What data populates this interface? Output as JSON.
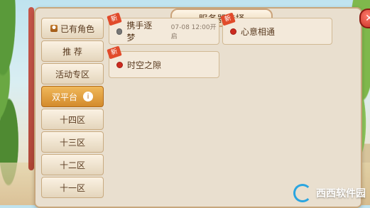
{
  "title": "服务器选择",
  "close": {
    "label": "✕"
  },
  "left_menu": {
    "items": [
      {
        "label": "已有角色"
      },
      {
        "label": "推 荐"
      },
      {
        "label": "活动专区"
      },
      {
        "label": "双平台",
        "info": "i",
        "active": true
      },
      {
        "label": "十四区"
      },
      {
        "label": "十三区"
      },
      {
        "label": "十二区"
      },
      {
        "label": "十一区"
      }
    ]
  },
  "servers": [
    {
      "name": "携手逐梦",
      "status": "gray",
      "time": "07-08 12:00开启",
      "new": "新"
    },
    {
      "name": "心意相通",
      "status": "red",
      "new": "新"
    },
    {
      "name": "时空之隙",
      "status": "red",
      "new": "新"
    }
  ],
  "watermark": {
    "text": "西西软件园"
  },
  "colors": {
    "accent": "#d38b2c",
    "panel": "#e9dfcf",
    "status_red": "#cc2a1f",
    "status_gray": "#777777"
  }
}
